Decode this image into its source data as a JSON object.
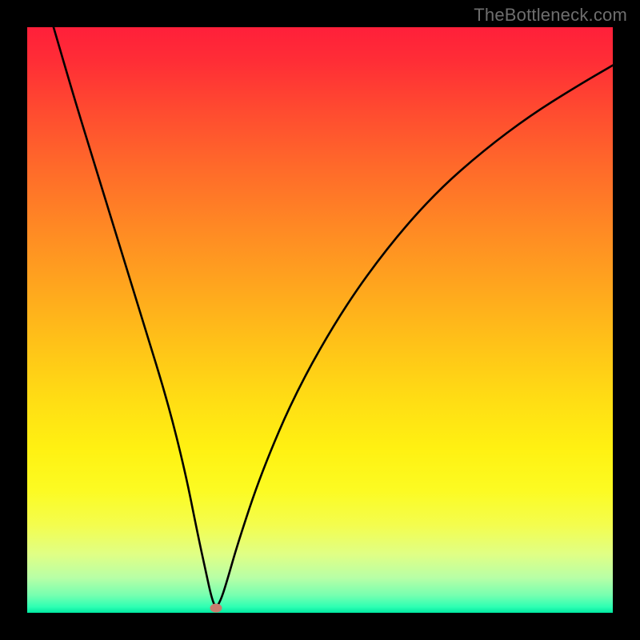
{
  "watermark": "TheBottleneck.com",
  "chart_data": {
    "type": "line",
    "title": "",
    "xlabel": "",
    "ylabel": "",
    "xlim": [
      0,
      100
    ],
    "ylim": [
      0,
      100
    ],
    "grid": false,
    "gradient_stops": [
      {
        "pct": 0,
        "color": "#ff1f3a"
      },
      {
        "pct": 50,
        "color": "#ffc218"
      },
      {
        "pct": 80,
        "color": "#fcfb22"
      },
      {
        "pct": 100,
        "color": "#00e8a0"
      }
    ],
    "series": [
      {
        "name": "bottleneck-curve",
        "x": [
          4.5,
          8,
          12,
          16,
          20,
          24,
          27,
          29,
          30.5,
          31.5,
          32.2,
          33,
          34,
          36,
          40,
          46,
          54,
          62,
          70,
          78,
          86,
          94,
          100
        ],
        "values": [
          100,
          88,
          75,
          62,
          49,
          36,
          24,
          14,
          7,
          2.5,
          0.8,
          2,
          5,
          12,
          24,
          38,
          52,
          63,
          72,
          79,
          85,
          90,
          93.5
        ]
      }
    ],
    "bottleneck_point": {
      "x": 32.2,
      "y": 0.8
    }
  }
}
